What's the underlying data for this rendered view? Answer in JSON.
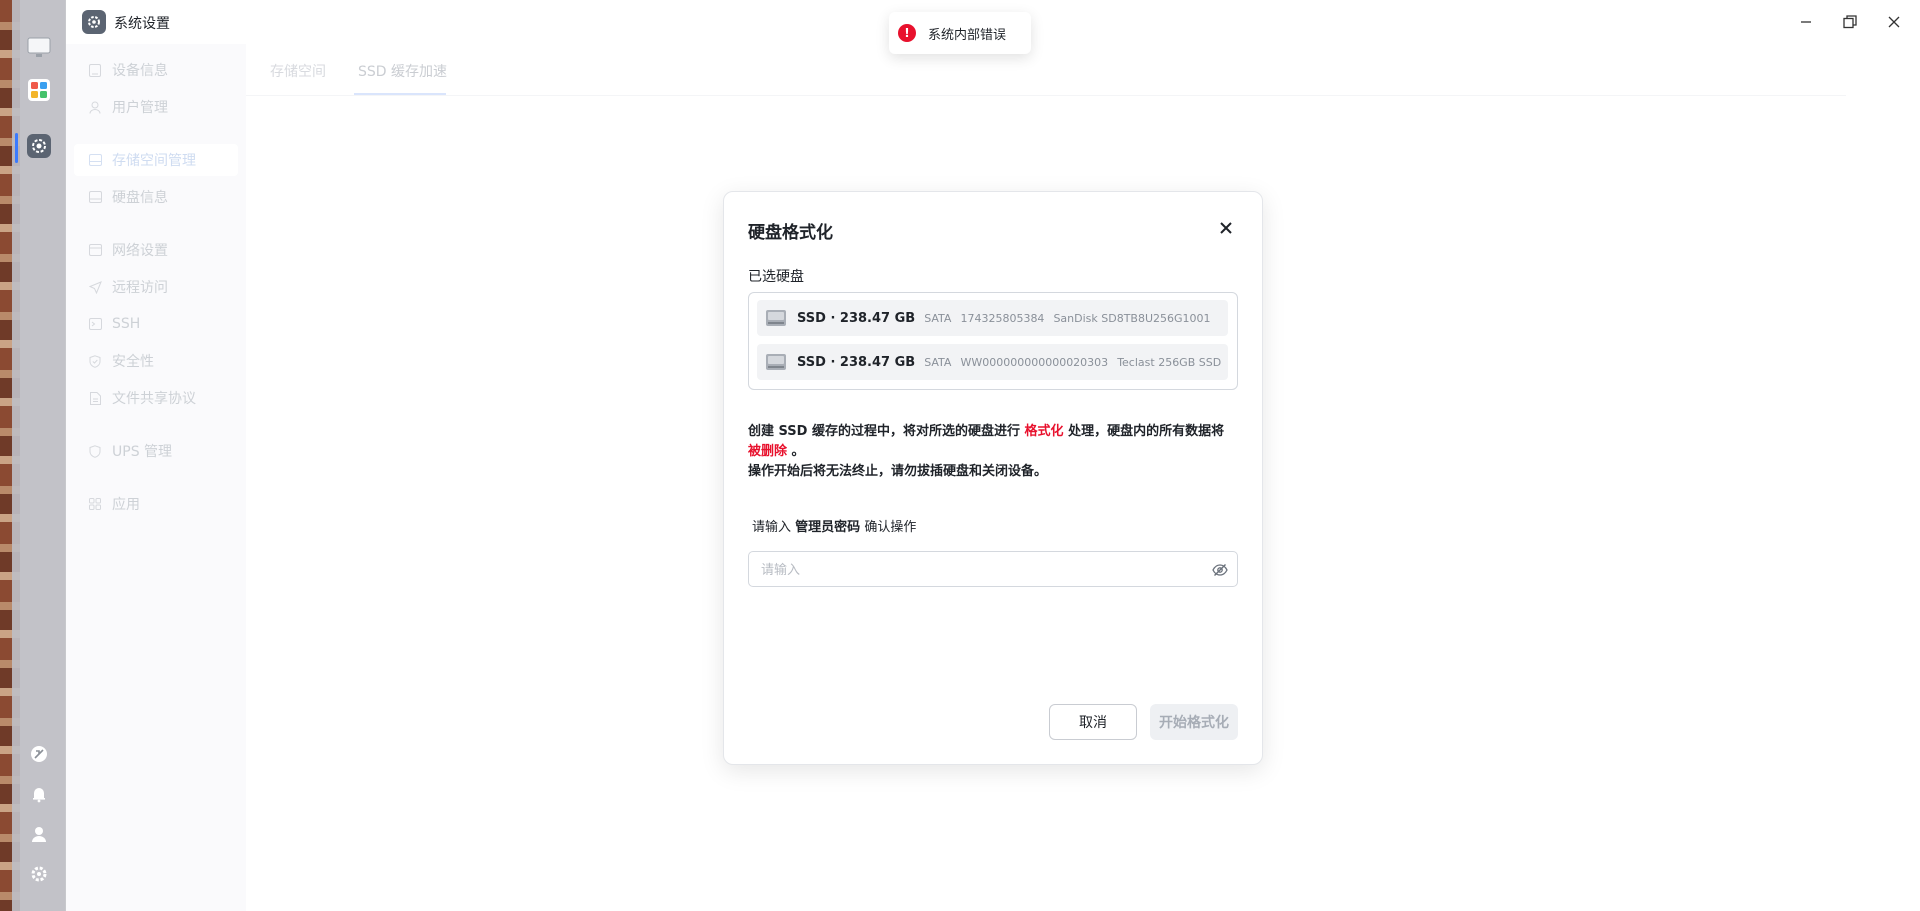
{
  "app": {
    "title": "系统设置"
  },
  "window_controls": {
    "minimize_icon": "minimize-icon",
    "maximize_icon": "maximize-icon",
    "close_icon": "close-icon"
  },
  "dock": {
    "items": [
      "monitor-icon",
      "apps-icon",
      "settings-icon",
      "accessibility-icon",
      "bell-icon",
      "user-icon",
      "gear-icon"
    ]
  },
  "sidebar": {
    "items": [
      {
        "label": "设备信息",
        "icon": "device-icon"
      },
      {
        "label": "用户管理",
        "icon": "user-icon"
      },
      {
        "label": "存储空间管理",
        "icon": "storage-icon",
        "active": true
      },
      {
        "label": "硬盘信息",
        "icon": "disk-icon"
      },
      {
        "label": "网络设置",
        "icon": "network-icon"
      },
      {
        "label": "远程访问",
        "icon": "send-icon"
      },
      {
        "label": "SSH",
        "icon": "terminal-icon"
      },
      {
        "label": "安全性",
        "icon": "shield-icon"
      },
      {
        "label": "文件共享协议",
        "icon": "file-icon"
      },
      {
        "label": "UPS 管理",
        "icon": "ups-icon"
      },
      {
        "label": "应用",
        "icon": "grid-icon"
      }
    ]
  },
  "tabs": [
    {
      "label": "存储空间"
    },
    {
      "label": "SSD 缓存加速",
      "active": true
    }
  ],
  "toast": {
    "text": "系统内部错误",
    "color": "#e8112d"
  },
  "dialog": {
    "title": "硬盘格式化",
    "selected_label": "已选硬盘",
    "disks": [
      {
        "main": "SSD · 238.47 GB",
        "bus": "SATA",
        "serial": "174325805384",
        "model": "SanDisk SD8TB8U256G1001"
      },
      {
        "main": "SSD · 238.47 GB",
        "bus": "SATA",
        "serial": "WW000000000000020303",
        "model": "Teclast 256GB SSD"
      }
    ],
    "warning": {
      "part1": "创建 SSD 缓存的过程中，将对所选的硬盘进行",
      "highlight1": "格式化",
      "part2": "处理，硬盘内的所有数据将",
      "highlight2": "被删除",
      "part3": "。",
      "line2": "操作开始后将无法终止，请勿拔插硬盘和关闭设备。"
    },
    "password_prompt": {
      "prefix": "请输入",
      "strong": "管理员密码",
      "suffix": "确认操作"
    },
    "password": {
      "placeholder": "请输入",
      "value": ""
    },
    "cancel_label": "取消",
    "start_label": "开始格式化",
    "accent_red": "#e8112d"
  }
}
